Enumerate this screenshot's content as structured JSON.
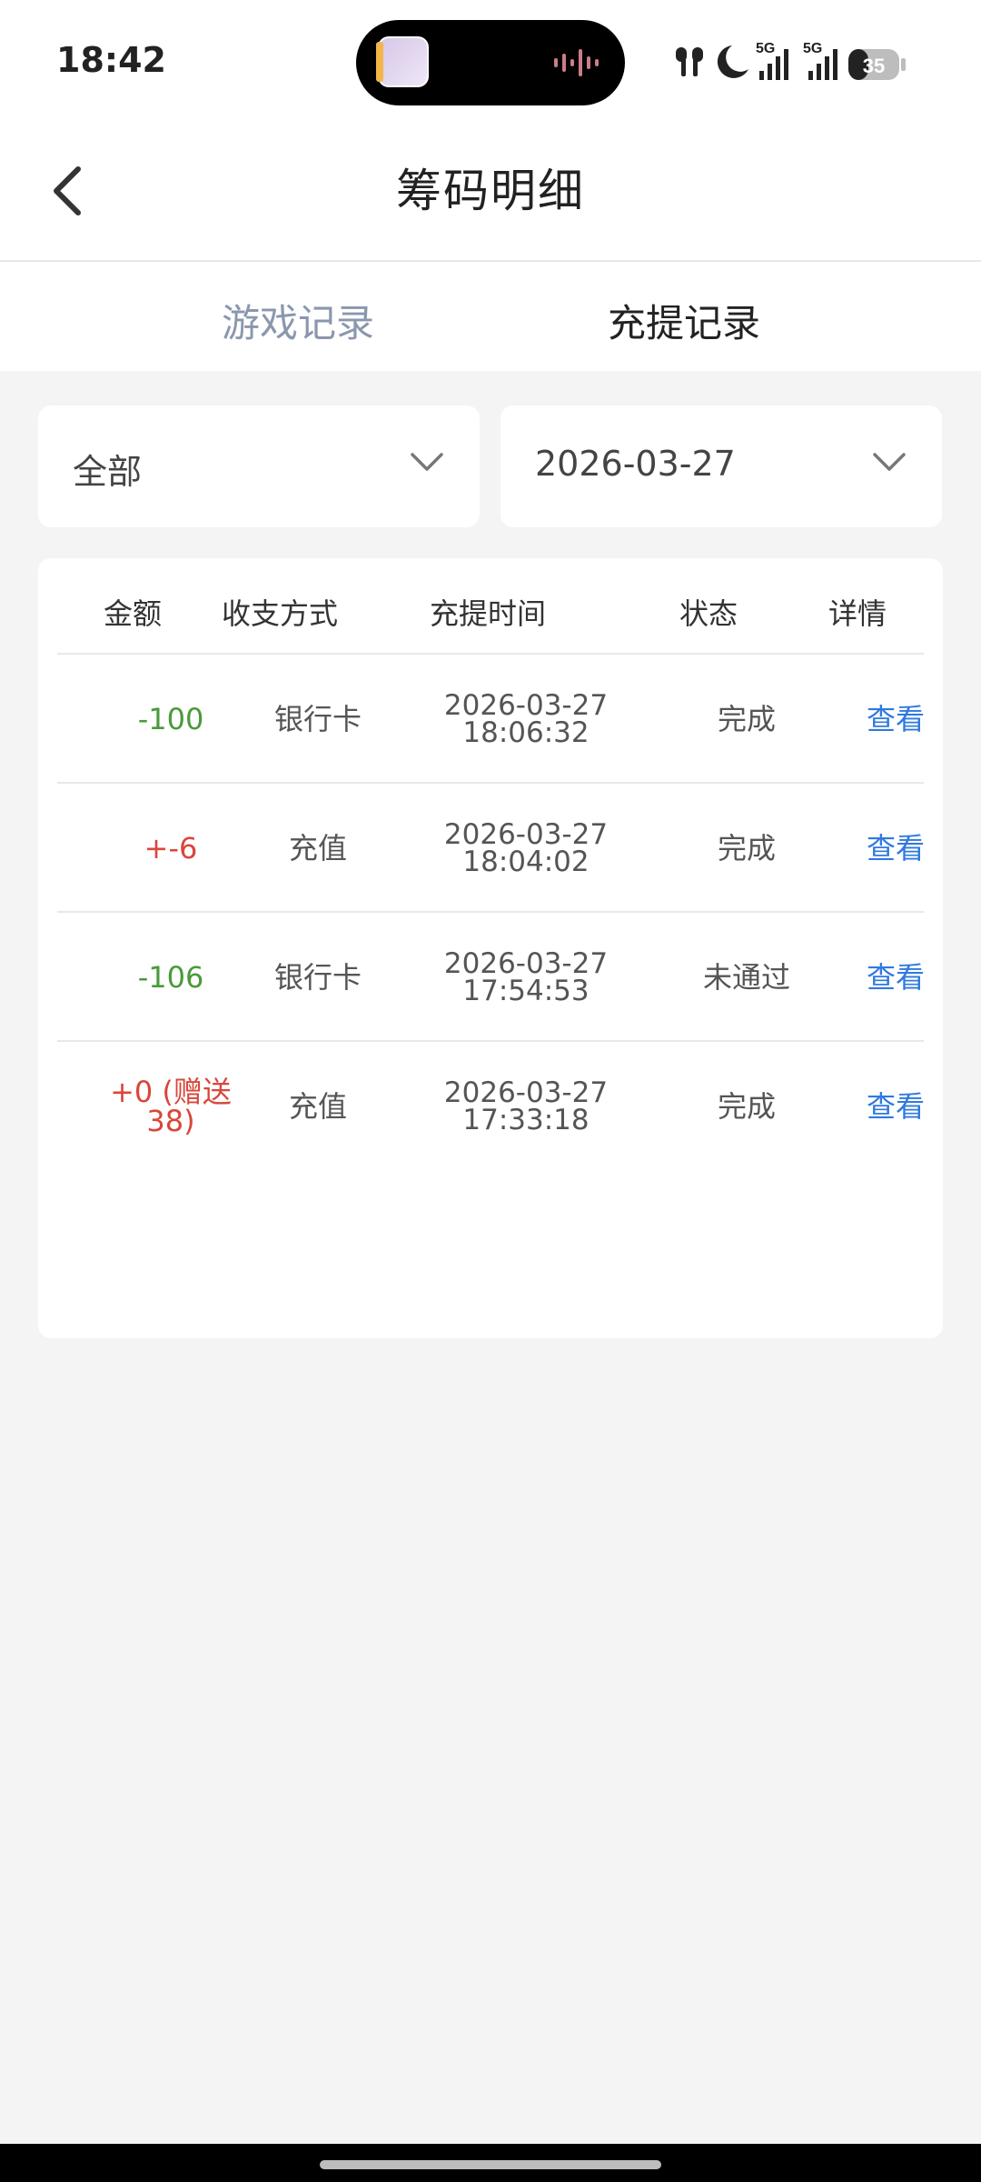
{
  "status_bar": {
    "time": "18:42",
    "battery": "35",
    "network_labels": [
      "5G",
      "5G"
    ],
    "icons": [
      "earbuds-icon",
      "moon-icon",
      "signal-icon",
      "signal-icon",
      "battery-icon"
    ]
  },
  "header": {
    "title": "筹码明细",
    "back_icon": "chevron-left-icon"
  },
  "tabs": [
    {
      "label": "游戏记录",
      "active": false
    },
    {
      "label": "充提记录",
      "active": true
    }
  ],
  "filters": {
    "type": {
      "value": "全部",
      "icon": "chevron-down-icon"
    },
    "date": {
      "value": "2026-03-27",
      "icon": "chevron-down-icon"
    }
  },
  "table": {
    "headers": [
      "金额",
      "收支方式",
      "充提时间",
      "状态",
      "详情"
    ],
    "rows": [
      {
        "amount": "-100",
        "amount_color": "#4a9a3a",
        "method": "银行卡",
        "date": "2026-03-27",
        "time": "18:06:32",
        "status": "完成",
        "detail": "查看"
      },
      {
        "amount": "+-6",
        "amount_color": "#d9463a",
        "method": "充值",
        "date": "2026-03-27",
        "time": "18:04:02",
        "status": "完成",
        "detail": "查看"
      },
      {
        "amount": "-106",
        "amount_color": "#4a9a3a",
        "method": "银行卡",
        "date": "2026-03-27",
        "time": "17:54:53",
        "status": "未通过",
        "detail": "查看"
      },
      {
        "amount": "+0 (赠送38)",
        "amount_color": "#d9463a",
        "method": "充值",
        "date": "2026-03-27",
        "time": "17:33:18",
        "status": "完成",
        "detail": "查看"
      }
    ]
  },
  "colors": {
    "link": "#2f79e0",
    "negative": "#4a9a3a",
    "positive": "#d9463a",
    "inactive_tab": "#8a97ad"
  }
}
